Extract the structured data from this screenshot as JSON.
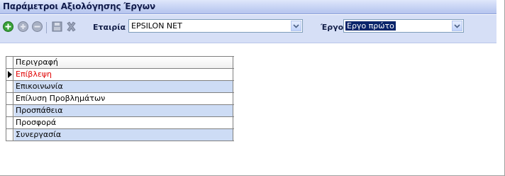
{
  "window": {
    "title": "Παράμετροι Αξιολόγησης Έργων"
  },
  "toolbar": {
    "icons": [
      "add-icon",
      "edit-icon",
      "delete-icon",
      "save-icon",
      "cancel-icon"
    ],
    "company_label": "Εταιρία",
    "company_value": "EPSILON NET",
    "project_label": "Έργο",
    "project_value": "Εργο πρώτο"
  },
  "grid": {
    "column_header": "Περιγραφή",
    "rows": [
      "Επίβλεψη",
      "Επικοινωνία",
      "Επίλυση Προβλημάτων",
      "Προσπάθεια",
      "Προσφορά",
      "Συνεργασία"
    ],
    "current_row_index": 0
  },
  "colors": {
    "title_bar": "#c7d3f4",
    "toolbar": "#d6dff6",
    "alt_row": "#cddcf5",
    "current_row_text": "#e00000",
    "selection": "#0a246a"
  }
}
